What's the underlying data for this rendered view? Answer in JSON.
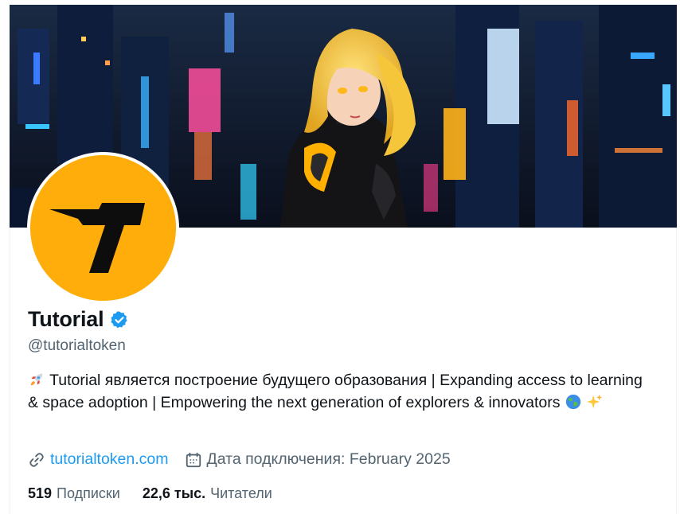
{
  "banner": {
    "icon": "anime-character-banner-image"
  },
  "avatar": {
    "icon": "tutorial-logo-T",
    "bg_color": "#ffad0a"
  },
  "profile": {
    "display_name": "Tutorial",
    "verified_icon": "verified-badge-icon",
    "handle": "@tutorialtoken",
    "bio": {
      "emoji_start": "rocket",
      "text": "Tutorial является построение будущего образования | Expanding access to learning & space adoption | Empowering the next generation of explorers & innovators",
      "emoji_end_1": "globe",
      "emoji_end_2": "sparkles"
    }
  },
  "meta": {
    "website": {
      "icon": "link-icon",
      "text": "tutorialtoken.com"
    },
    "joined": {
      "icon": "calendar-icon",
      "text": "Дата подключения: February 2025"
    }
  },
  "stats": {
    "following": {
      "count": "519",
      "label": "Подписки"
    },
    "followers": {
      "count": "22,6 тыс.",
      "label": "Читатели"
    }
  },
  "colors": {
    "accent": "#1d9bf0",
    "secondary_text": "#536471",
    "primary_text": "#0f1419"
  }
}
